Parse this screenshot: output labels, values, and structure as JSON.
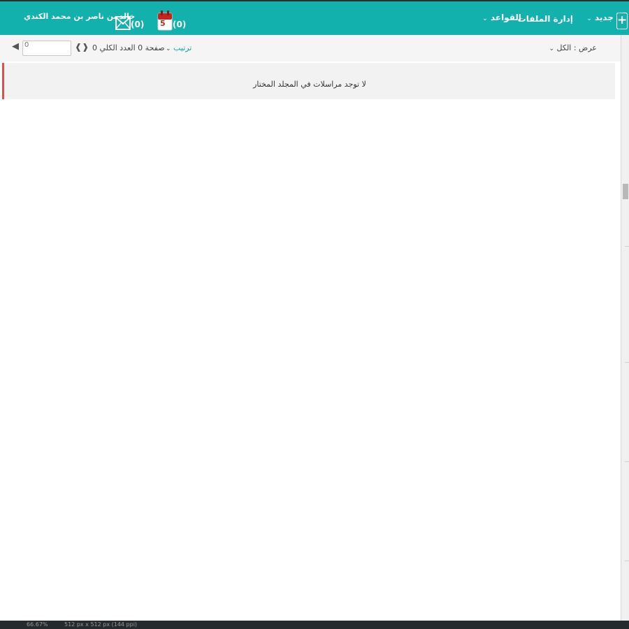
{
  "header": {
    "new_label": "جديد",
    "new_plus": "+",
    "file_management": "إدارة الملفات",
    "rules": "القواعد",
    "calendar_count": "(0)",
    "calendar_day": "5",
    "mail_count": "(0)",
    "user_name": "خالد بن ناصر بن محمد الكندي",
    "icons": [
      "plus-icon",
      "chevron-down-icon",
      "calendar-icon",
      "envelope-icon"
    ],
    "accent_color": "#12b1ad"
  },
  "toolbar": {
    "view_label": "عرض : الكل",
    "sort_label": "ترتيب",
    "page_info": "صفحة 0 العدد الكلي 0",
    "page_input_value": "0"
  },
  "messages": {
    "empty_text": "لا توجد مراسلات في المجلد المختار",
    "alert_color": "#e34d4d"
  },
  "status": {
    "zoom": "66.67%",
    "dimensions": "512 px x 512 px (144 ppi)"
  }
}
